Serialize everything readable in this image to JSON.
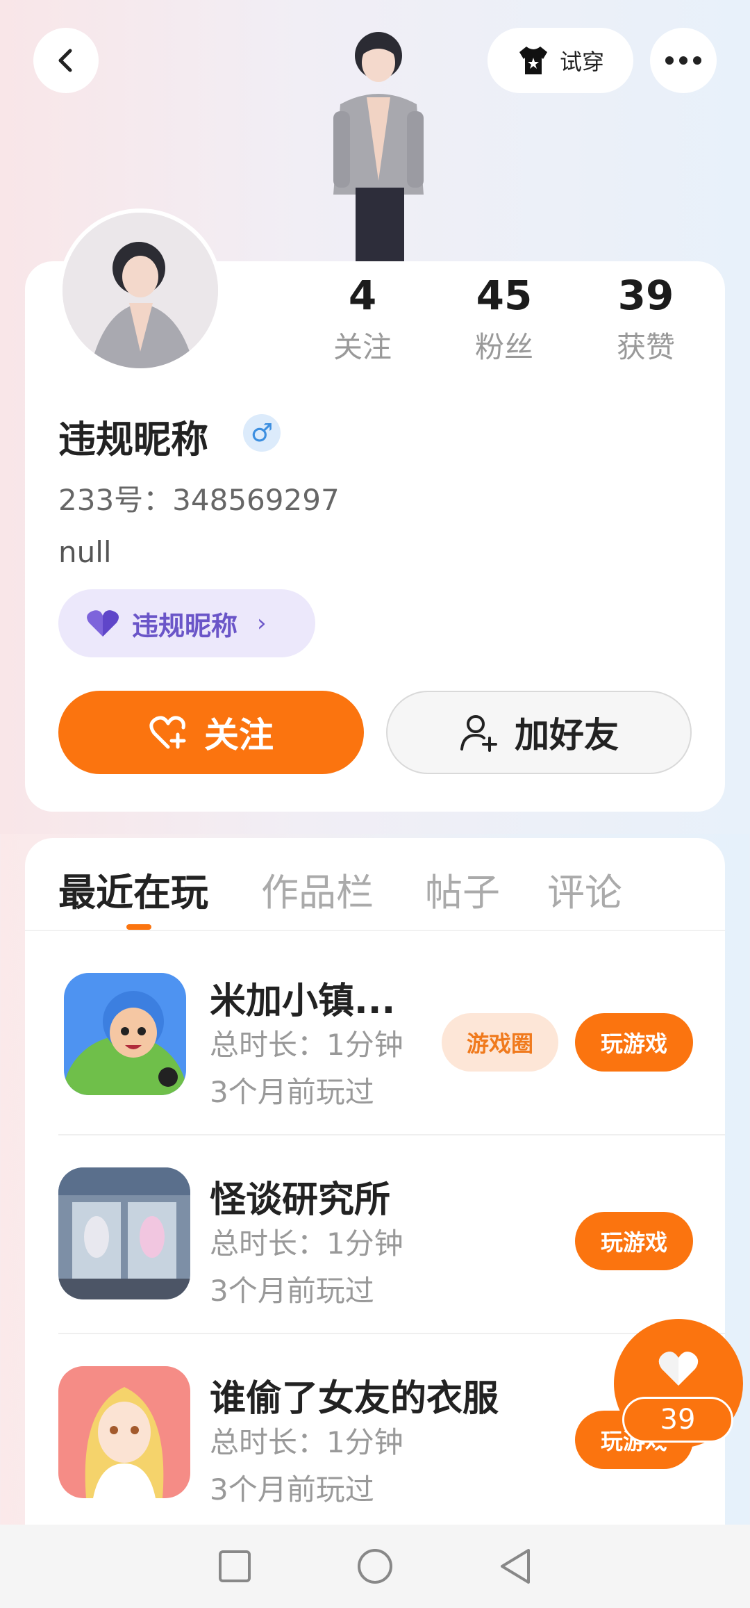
{
  "header": {
    "tryon_label": "试穿"
  },
  "stats": [
    {
      "value": "4",
      "label": "关注"
    },
    {
      "value": "45",
      "label": "粉丝"
    },
    {
      "value": "39",
      "label": "获赞"
    }
  ],
  "profile": {
    "nickname": "违规昵称",
    "gender_symbol": "♂",
    "uid": "233号：348569297",
    "bio": "null",
    "tag_label": "违规昵称",
    "follow_label": "关注",
    "add_friend_label": "加好友"
  },
  "tabs": [
    {
      "label": "最近在玩",
      "active": true
    },
    {
      "label": "作品栏",
      "active": false
    },
    {
      "label": "帖子",
      "active": false
    },
    {
      "label": "评论",
      "active": false
    }
  ],
  "games": [
    {
      "title": "米加小镇...",
      "time": "总时长：1分钟",
      "last": "3个月前玩过",
      "circle_label": "游戏圈",
      "play_label": "玩游戏"
    },
    {
      "title": "怪谈研究所",
      "time": "总时长：1分钟",
      "last": "3个月前玩过",
      "play_label": "玩游戏"
    },
    {
      "title": "谁偷了女友的衣服",
      "time": "总时长：1分钟",
      "last": "3个月前玩过",
      "play_label": "玩游戏"
    }
  ],
  "fab": {
    "count": "39"
  },
  "colors": {
    "accent": "#fb740f",
    "tag_purple": "#6a55c8"
  }
}
